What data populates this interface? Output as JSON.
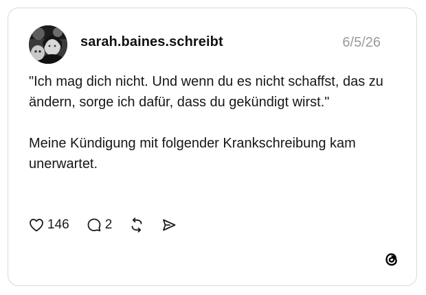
{
  "post": {
    "username": "sarah.baines.schreibt",
    "date": "6/5/26",
    "paragraphs": [
      "\"Ich mag dich nicht. Und wenn du es nicht schaffst, das zu ändern, sorge ich dafür, dass du gekündigt wirst.\"",
      "Meine Kündigung mit folgender Krankschreibung kam unerwartet."
    ],
    "likes": "146",
    "replies": "2"
  },
  "icons": {
    "like": "heart-icon",
    "reply": "speech-bubble-icon",
    "repost": "repost-icon",
    "share": "send-icon",
    "brand": "threads-logo"
  },
  "colors": {
    "text": "#161616",
    "muted": "#9a9a9a",
    "border": "#d9d9d9"
  }
}
